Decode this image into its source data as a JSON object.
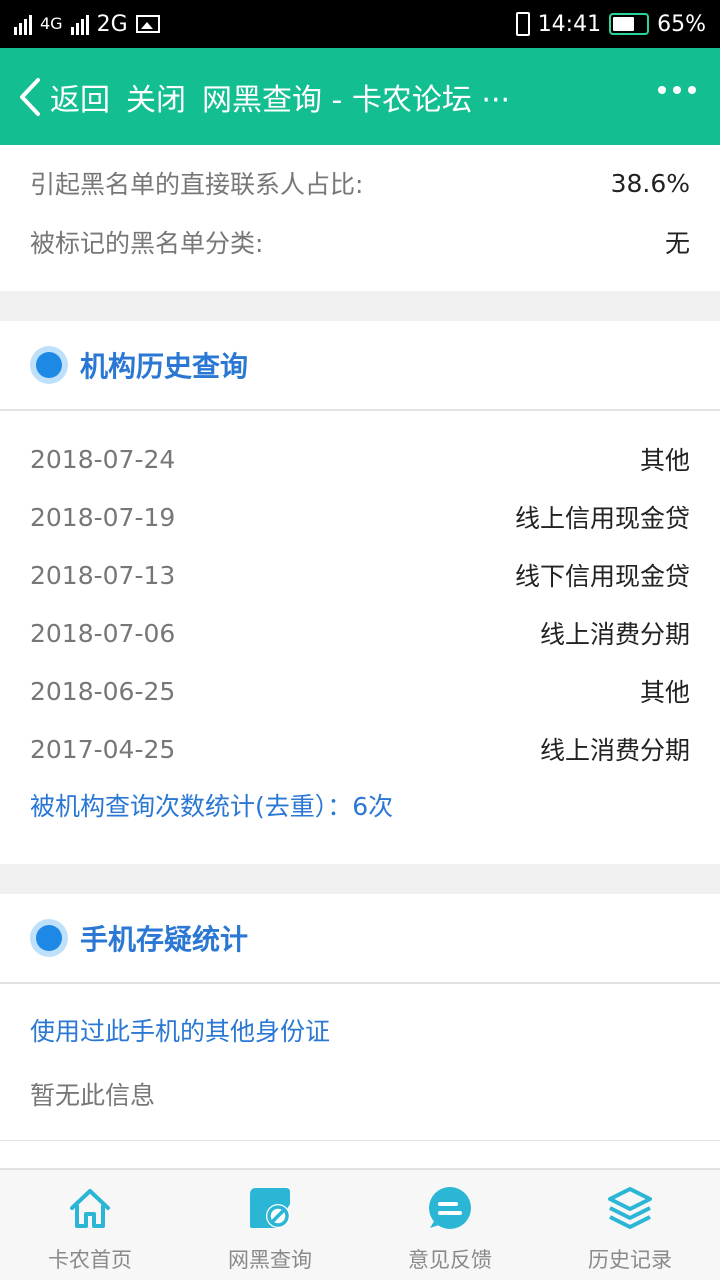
{
  "status_bar": {
    "net1": "4G",
    "net2": "2G",
    "time": "14:41",
    "battery": "65%",
    "battery_level": 0.65
  },
  "header": {
    "back_label": "返回",
    "close_label": "关闭",
    "title": "网黑查询 - 卡农论坛 ···"
  },
  "blacklist": {
    "rows": [
      {
        "label": "引起黑名单的直接联系人占比:",
        "value": "38.6%"
      },
      {
        "label": "被标记的黑名单分类:",
        "value": "无"
      }
    ]
  },
  "institution_history": {
    "title": "机构历史查询",
    "rows": [
      {
        "date": "2018-07-24",
        "type": "其他"
      },
      {
        "date": "2018-07-19",
        "type": "线上信用现金贷"
      },
      {
        "date": "2018-07-13",
        "type": "线下信用现金贷"
      },
      {
        "date": "2018-07-06",
        "type": "线上消费分期"
      },
      {
        "date": "2018-06-25",
        "type": "其他"
      },
      {
        "date": "2017-04-25",
        "type": "线上消费分期"
      }
    ],
    "summary": "被机构查询次数统计(去重）：6次"
  },
  "phone_suspicion": {
    "title": "手机存疑统计",
    "subtitle": "使用过此手机的其他身份证",
    "empty_text": "暂无此信息"
  },
  "bottom_nav": {
    "items": [
      {
        "label": "卡农首页",
        "icon": "home-icon"
      },
      {
        "label": "网黑查询",
        "icon": "blacklist-query-icon"
      },
      {
        "label": "意见反馈",
        "icon": "feedback-icon"
      },
      {
        "label": "历史记录",
        "icon": "history-layers-icon"
      }
    ],
    "accent": "#2bb6d6"
  },
  "colors": {
    "title_bar": "#13bf91",
    "section_title": "#2a78d3",
    "dot": "#1e88e5"
  }
}
